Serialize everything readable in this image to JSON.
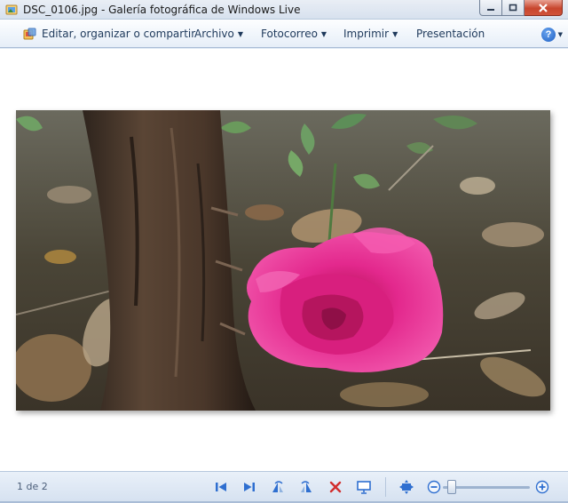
{
  "window": {
    "title": "DSC_0106.jpg - Galería fotográfica de Windows Live"
  },
  "commandbar": {
    "edit_label": "Editar, organizar o compartir",
    "menus": [
      {
        "label": "Archivo"
      },
      {
        "label": "Fotocorreo"
      },
      {
        "label": "Imprimir"
      },
      {
        "label": "Presentación"
      }
    ],
    "help_label": "?"
  },
  "photo": {
    "subject": "pink-rose-photo"
  },
  "statusbar": {
    "counter": "1 de 2",
    "zoom_level": 0.06
  },
  "colors": {
    "accent": "#1e395b",
    "rose": "#e8208a",
    "close_red": "#c8452d"
  },
  "icons": [
    "previous-icon",
    "next-icon",
    "rotate-left-icon",
    "rotate-right-icon",
    "delete-icon",
    "slideshow-icon",
    "actual-size-icon",
    "zoom-out-icon",
    "zoom-in-icon"
  ]
}
